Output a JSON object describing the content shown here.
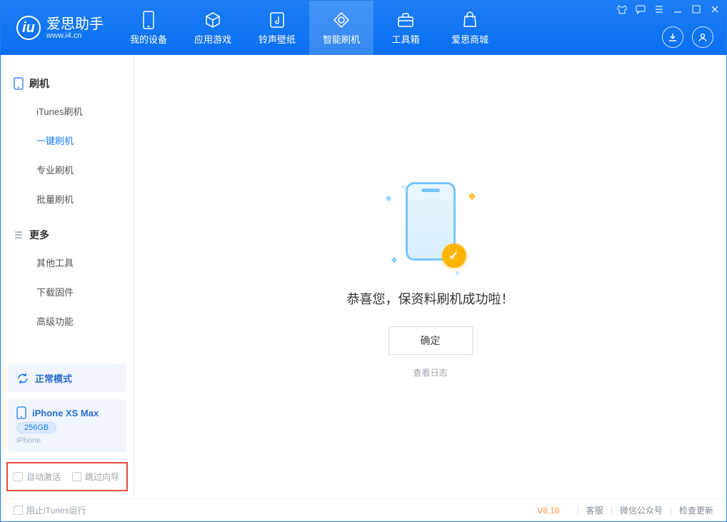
{
  "app": {
    "name": "爱思助手",
    "site": "www.i4.cn",
    "version": "V8.16"
  },
  "nav": [
    {
      "label": "我的设备",
      "icon": "device-icon"
    },
    {
      "label": "应用游戏",
      "icon": "cube-icon"
    },
    {
      "label": "铃声壁纸",
      "icon": "music-icon"
    },
    {
      "label": "智能刷机",
      "icon": "refresh-icon",
      "active": true
    },
    {
      "label": "工具箱",
      "icon": "toolbox-icon"
    },
    {
      "label": "爱思商城",
      "icon": "bag-icon"
    }
  ],
  "sidebar": {
    "groups": [
      {
        "title": "刷机",
        "items": [
          "iTunes刷机",
          "一键刷机",
          "专业刷机",
          "批量刷机"
        ],
        "activeIndex": 1
      },
      {
        "title": "更多",
        "items": [
          "其他工具",
          "下载固件",
          "高级功能"
        ],
        "activeIndex": -1
      }
    ],
    "status": {
      "label": "正常模式"
    },
    "device": {
      "name": "iPhone XS Max",
      "capacity": "256GB",
      "sub": "iPhone"
    },
    "checks": {
      "auto_activate": "自动激活",
      "skip_guide": "跳过向导"
    }
  },
  "result": {
    "message": "恭喜您，保资料刷机成功啦！",
    "ok_label": "确定",
    "log_label": "查看日志"
  },
  "footer": {
    "block_itunes": "阻止iTunes运行",
    "links": [
      "客服",
      "微信公众号",
      "检查更新"
    ]
  }
}
